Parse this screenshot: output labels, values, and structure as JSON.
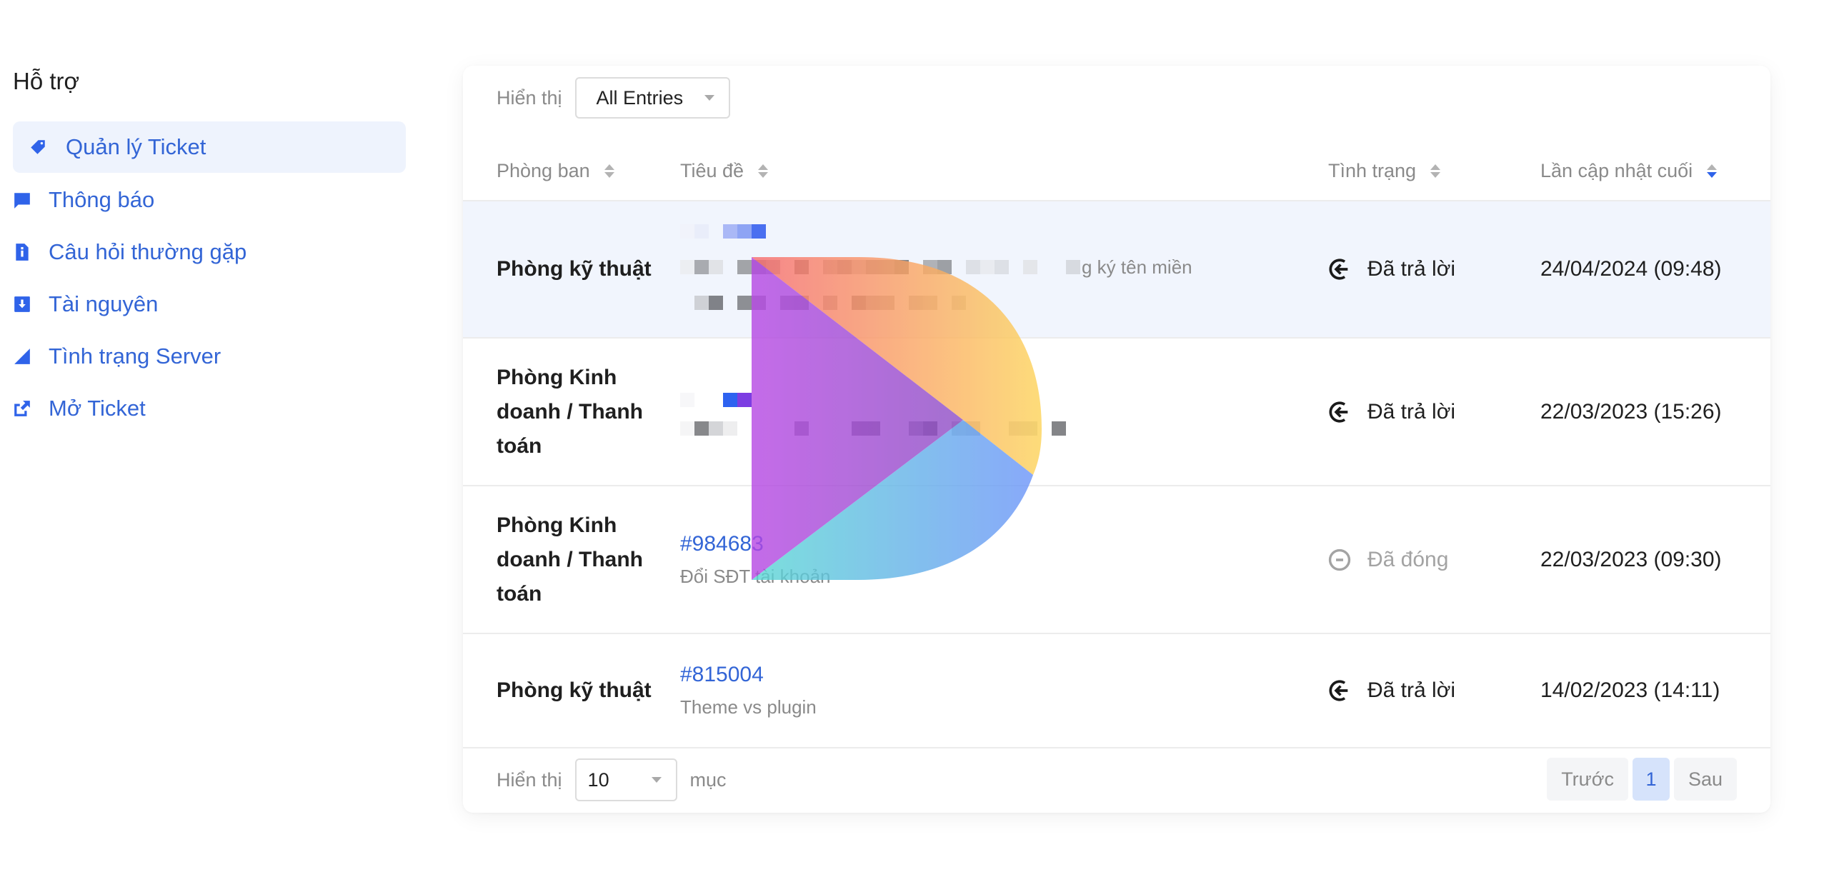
{
  "sidebar": {
    "title": "Hỗ trợ",
    "items": [
      {
        "label": "Quản lý Ticket",
        "icon": "tag-icon",
        "active": true
      },
      {
        "label": "Thông báo",
        "icon": "comment-icon",
        "active": false
      },
      {
        "label": "Câu hỏi thường gặp",
        "icon": "info-file-icon",
        "active": false
      },
      {
        "label": "Tài nguyên",
        "icon": "download-icon",
        "active": false
      },
      {
        "label": "Tình trạng Server",
        "icon": "signal-icon",
        "active": false
      },
      {
        "label": "Mở Ticket",
        "icon": "external-link-icon",
        "active": false
      }
    ]
  },
  "table": {
    "show_label": "Hiển thị",
    "show_filter": "All Entries",
    "columns": [
      {
        "label": "Phòng ban",
        "sort": "none"
      },
      {
        "label": "Tiêu đề",
        "sort": "none"
      },
      {
        "label": "Tình trạng",
        "sort": "none"
      },
      {
        "label": "Lần cập nhật cuối",
        "sort": "desc"
      }
    ],
    "rows": [
      {
        "department": "Phòng kỹ thuật",
        "ticket_id": "",
        "subject": "g ký tên miền",
        "subject_redacted": true,
        "status": "Đã trả lời",
        "status_icon": "reply-icon",
        "updated": "24/04/2024 (09:48)"
      },
      {
        "department": "Phòng Kinh doanh / Thanh toán",
        "ticket_id": "",
        "subject": "",
        "subject_redacted": true,
        "status": "Đã trả lời",
        "status_icon": "reply-icon",
        "updated": "22/03/2023 (15:26)"
      },
      {
        "department": "Phòng Kinh doanh / Thanh toán",
        "ticket_id": "#984683",
        "subject": "Đổi SĐT tài khoản",
        "subject_redacted": false,
        "status": "Đã đóng",
        "status_icon": "minus-circle-icon",
        "updated": "22/03/2023 (09:30)"
      },
      {
        "department": "Phòng kỹ thuật",
        "ticket_id": "#815004",
        "subject": "Theme vs plugin",
        "subject_redacted": false,
        "status": "Đã trả lời",
        "status_icon": "reply-icon",
        "updated": "14/02/2023 (14:11)"
      }
    ],
    "footer": {
      "show_label": "Hiển thị",
      "page_size": "10",
      "page_size_suffix": "mục",
      "prev_label": "Trước",
      "current_page": "1",
      "next_label": "Sau"
    }
  },
  "colors": {
    "accent": "#3365d6",
    "icon_blue": "#2f63e9",
    "row_highlight": "#f1f5fd",
    "muted_text": "#8a8a8a"
  }
}
